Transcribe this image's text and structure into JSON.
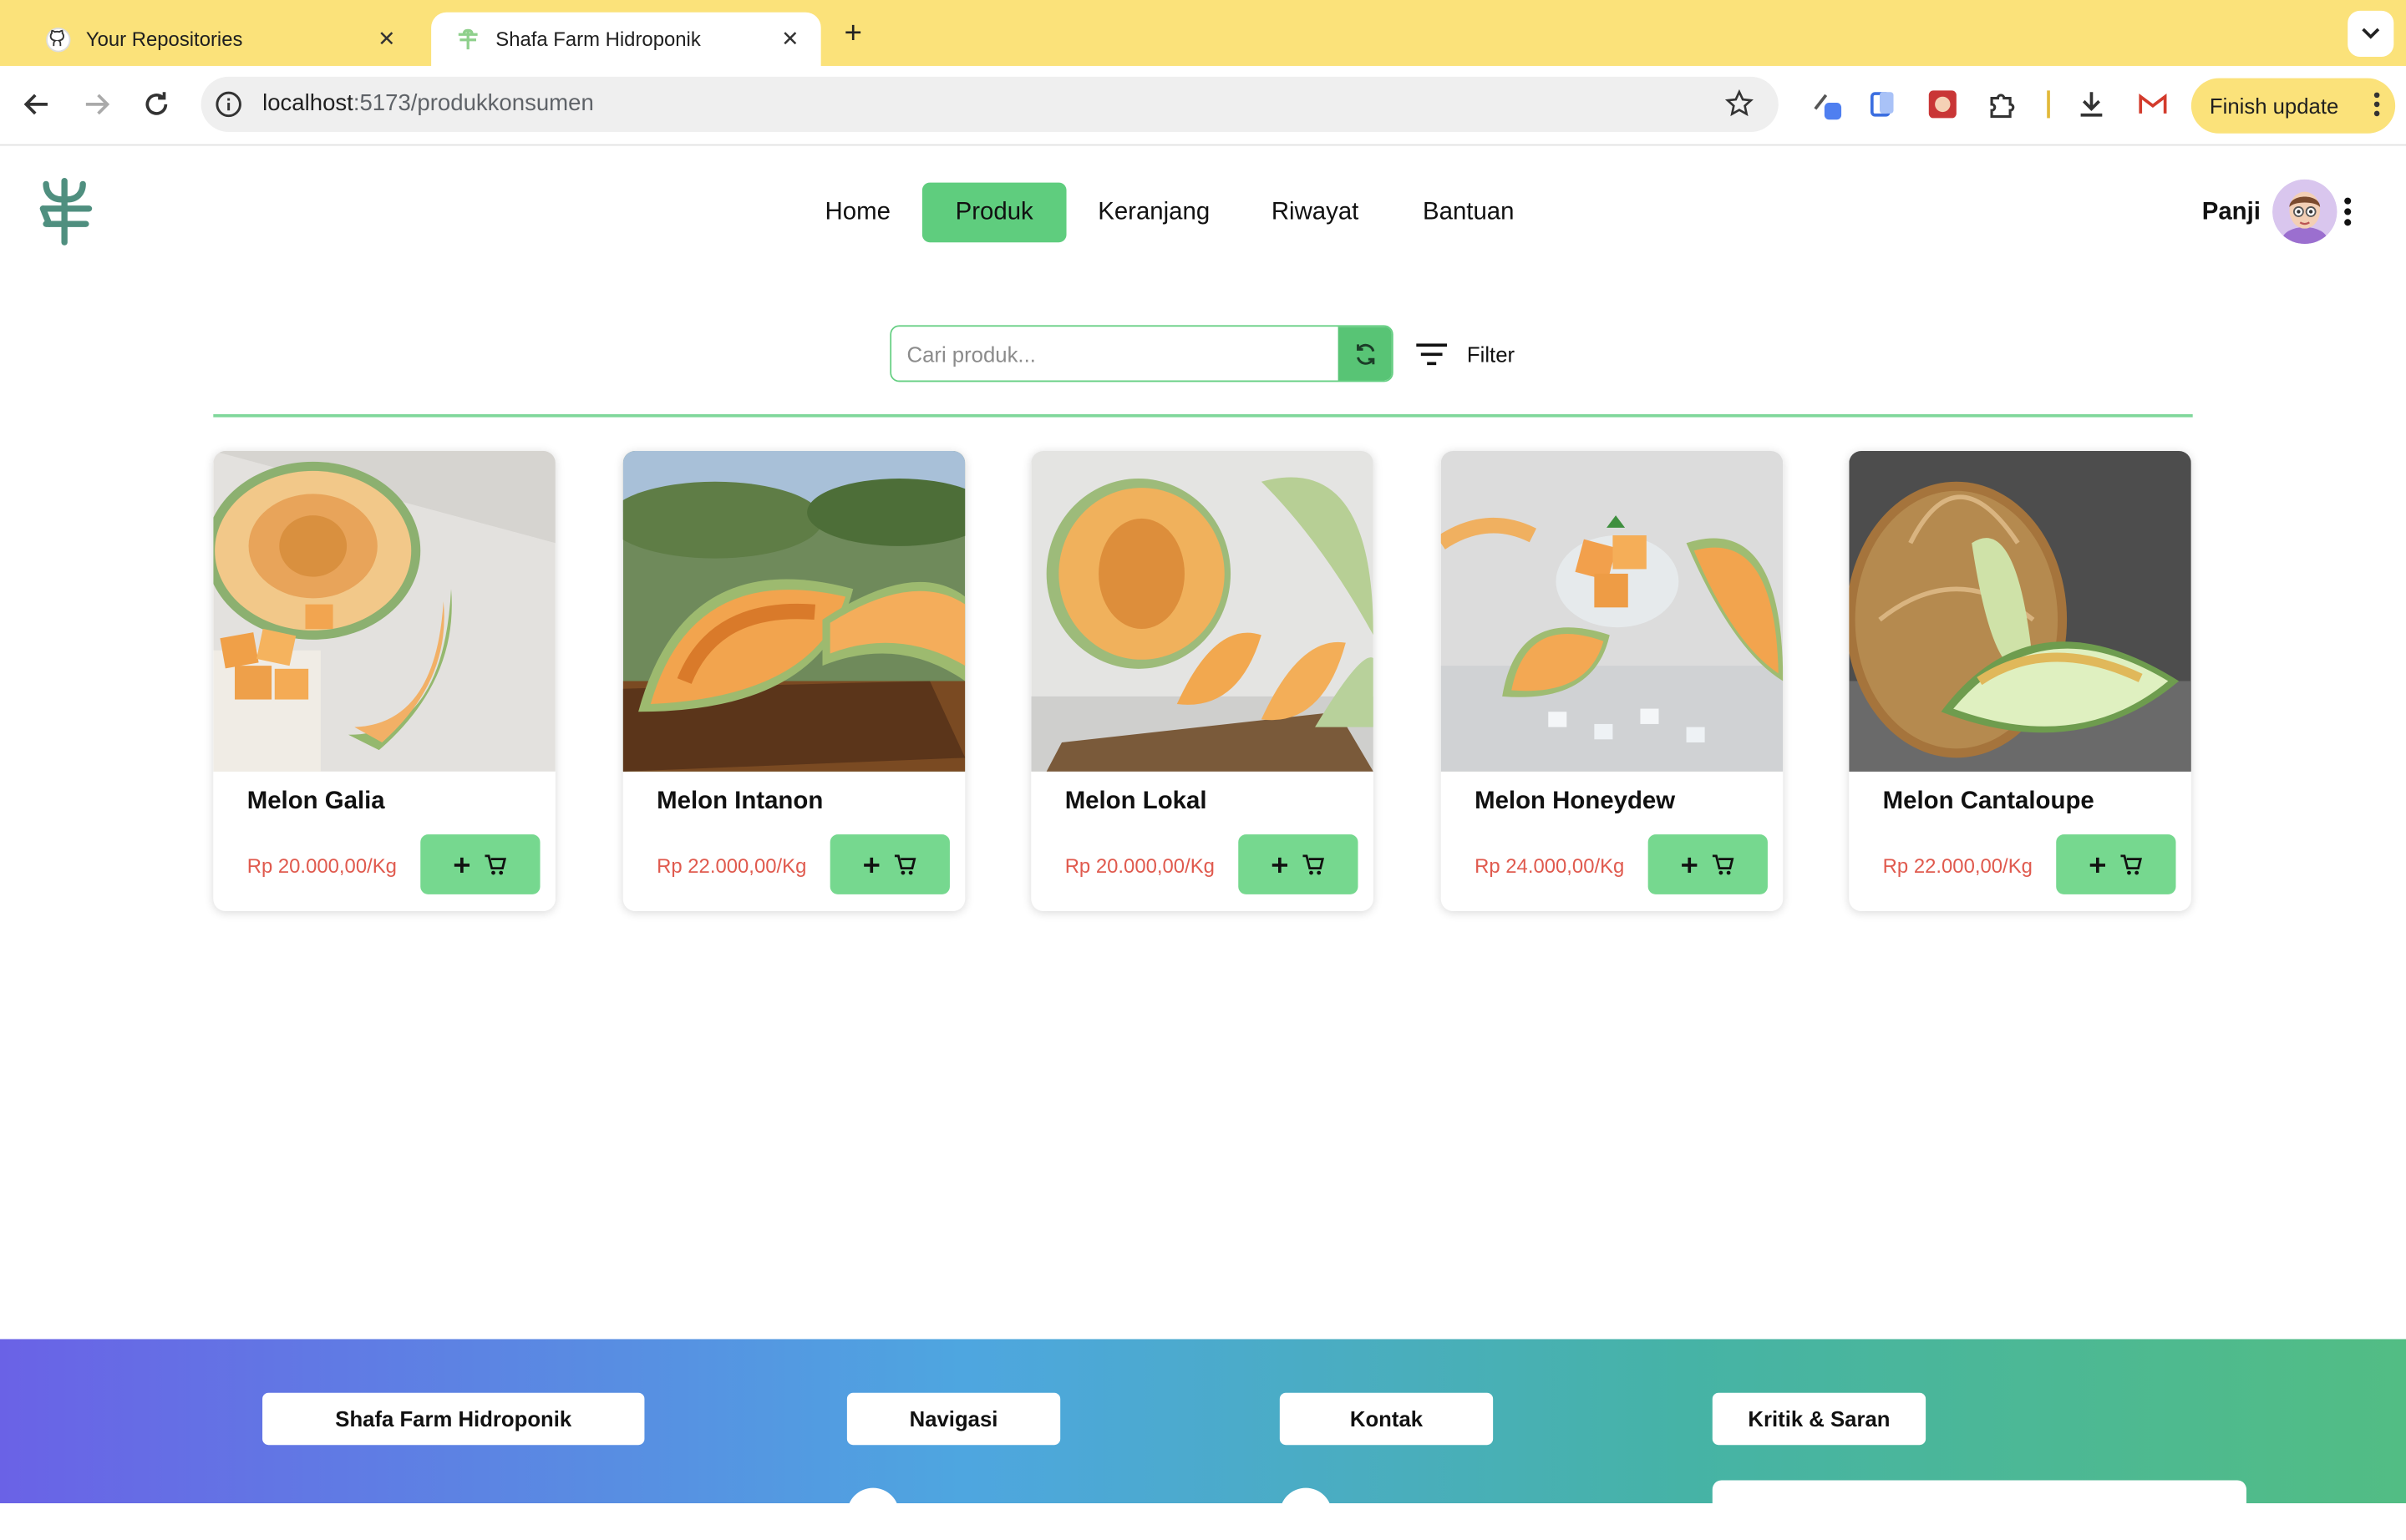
{
  "browser": {
    "tabs": [
      {
        "title": "Your Repositories",
        "icon": "github-icon"
      },
      {
        "title": "Shafa Farm Hidroponik",
        "icon": "shafa-farm-icon"
      }
    ],
    "url_host": "localhost",
    "url_path": ":5173/produkkonsumen",
    "finish_update": "Finish update"
  },
  "nav": {
    "items": [
      "Home",
      "Produk",
      "Keranjang",
      "Riwayat",
      "Bantuan"
    ],
    "active": "Produk",
    "user_name": "Panji"
  },
  "search": {
    "placeholder": "Cari produk...",
    "filter_label": "Filter"
  },
  "products": [
    {
      "name": "Melon Galia",
      "price": "Rp 20.000,00/Kg"
    },
    {
      "name": "Melon Intanon",
      "price": "Rp 22.000,00/Kg"
    },
    {
      "name": "Melon Lokal",
      "price": "Rp 20.000,00/Kg"
    },
    {
      "name": "Melon Honeydew",
      "price": "Rp 24.000,00/Kg"
    },
    {
      "name": "Melon Cantaloupe",
      "price": "Rp 22.000,00/Kg"
    }
  ],
  "footer": {
    "sections": [
      "Shafa Farm Hidroponik",
      "Navigasi",
      "Kontak",
      "Kritik & Saran"
    ]
  },
  "colors": {
    "accent_green": "#5fcd7e",
    "price_red": "#e05a4e",
    "tabbar_yellow": "#fbe27a"
  }
}
